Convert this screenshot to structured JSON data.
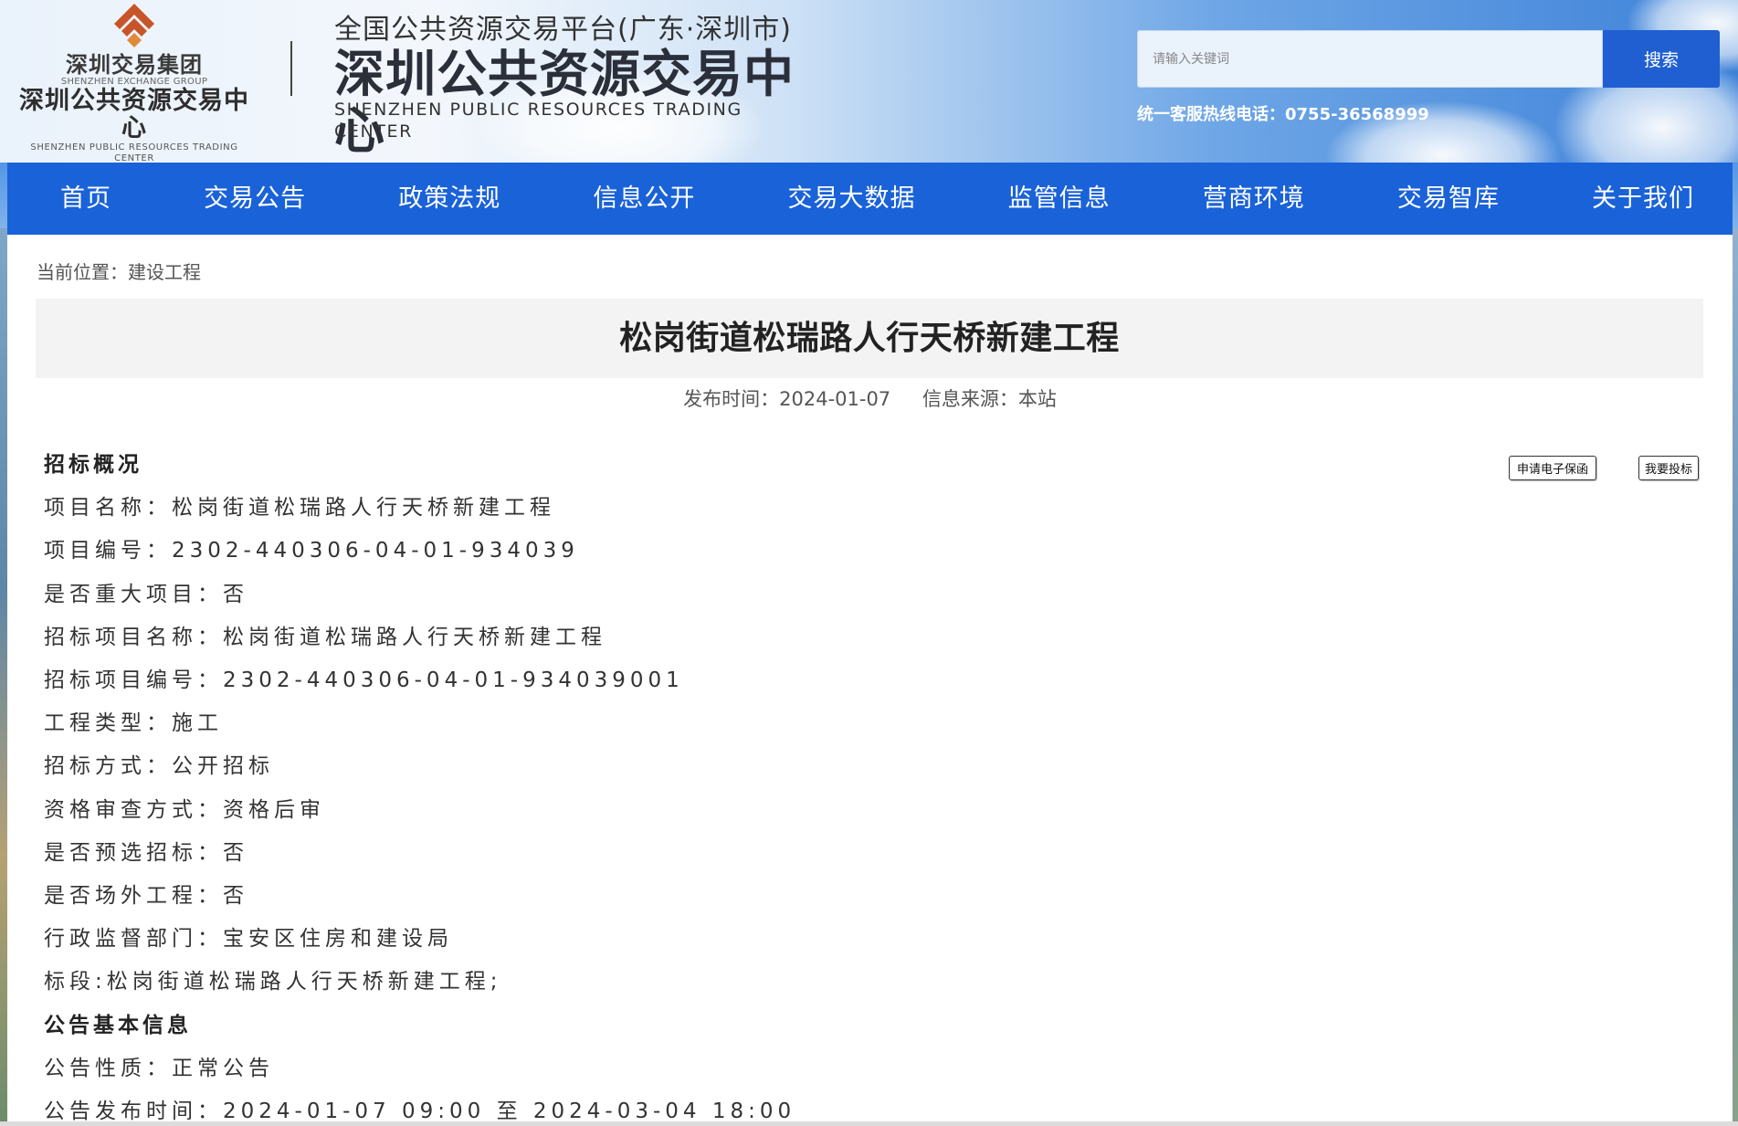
{
  "header": {
    "group_logo": {
      "cn_group": "深圳交易集团",
      "en_group": "SHENZHEN EXCHANGE GROUP",
      "cn_center": "深圳公共资源交易中心",
      "en_center": "SHENZHEN  PUBLIC  RESOURCES  TRADING  CENTER"
    },
    "platform_title": "全国公共资源交易平台(广东·深圳市)",
    "center_title": "深圳公共资源交易中心",
    "center_title_en": "SHENZHEN PUBLIC RESOURCES TRADING CENTER",
    "search": {
      "placeholder": "请输入关键词",
      "button_label": "搜索"
    },
    "hotline": "统一客服热线电话：0755-36568999"
  },
  "nav": {
    "items": [
      "首页",
      "交易公告",
      "政策法规",
      "信息公开",
      "交易大数据",
      "监管信息",
      "营商环境",
      "交易智库",
      "关于我们"
    ]
  },
  "breadcrumb": {
    "prefix": "当前位置：",
    "current": "建设工程"
  },
  "article": {
    "title": "松岗街道松瑞路人行天桥新建工程",
    "publish_time_label": "发布时间：2024-01-07",
    "source_label": "信息来源：本站",
    "actions": {
      "guarantee_label": "申请电子保函",
      "bid_label": "我要投标"
    },
    "lines": [
      {
        "text": "招标概况",
        "heading": true
      },
      {
        "text": "项目名称：松岗街道松瑞路人行天桥新建工程",
        "heading": false
      },
      {
        "text": "项目编号：2302-440306-04-01-934039",
        "heading": false
      },
      {
        "text": "是否重大项目：否",
        "heading": false
      },
      {
        "text": "招标项目名称：松岗街道松瑞路人行天桥新建工程",
        "heading": false
      },
      {
        "text": "招标项目编号：2302-440306-04-01-934039001",
        "heading": false
      },
      {
        "text": "工程类型：施工",
        "heading": false
      },
      {
        "text": "招标方式：公开招标",
        "heading": false
      },
      {
        "text": "资格审查方式：资格后审",
        "heading": false
      },
      {
        "text": "是否预选招标：否",
        "heading": false
      },
      {
        "text": "是否场外工程：否",
        "heading": false
      },
      {
        "text": "行政监督部门：宝安区住房和建设局",
        "heading": false
      },
      {
        "text": "标段:松岗街道松瑞路人行天桥新建工程;",
        "heading": false
      },
      {
        "text": "公告基本信息",
        "heading": true
      },
      {
        "text": "公告性质：正常公告",
        "heading": false
      },
      {
        "text": "公告发布时间：2024-01-07 09:00 至 2024-03-04 18:00",
        "heading": false
      }
    ]
  },
  "colors": {
    "nav_blue": "#1a62d8",
    "search_button": "#1f5fd1",
    "logo_orange": "#c8552a"
  }
}
